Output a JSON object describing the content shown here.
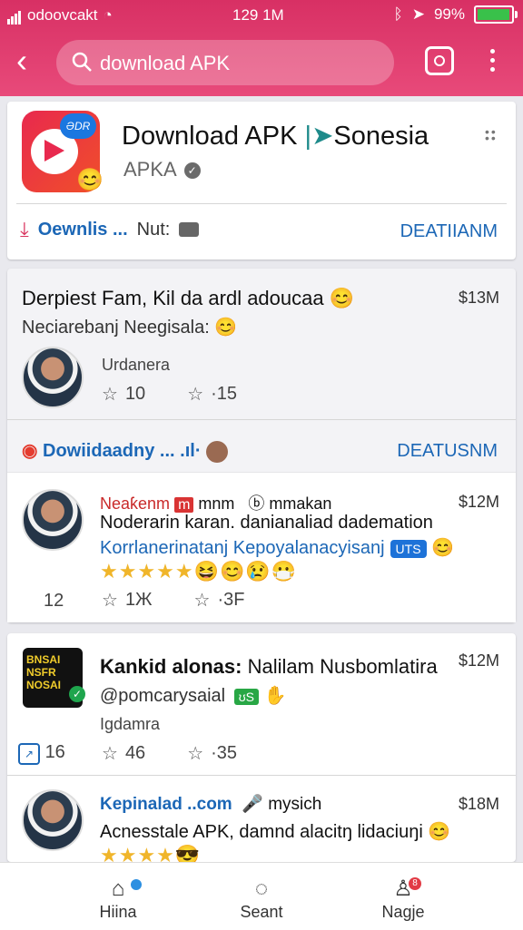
{
  "status": {
    "carrier": "odoovcakt",
    "time": "129 1M",
    "battery": "99%"
  },
  "search": {
    "query": "download APK"
  },
  "app": {
    "badge": "ƏDR",
    "title": "Download APK",
    "title_suffix": "Sonesia",
    "developer": "APKA",
    "downloads_label": "Oewnlis ...",
    "next_label": "Nut:",
    "detail_link": "DEATIIANM"
  },
  "post1": {
    "title": "Derpiest Fam, Kil da ardl adoucaa",
    "subtitle": "Neciarebanj Neegisala:",
    "price": "$13M",
    "author": "Urdanera",
    "likes": "10",
    "shares": "·15"
  },
  "section": {
    "label": "Dowiidaadny ...",
    "link": "DEATUSNM"
  },
  "post2": {
    "tag": "Neaƙenm",
    "handle_suffix": "mnm",
    "by": "mmakan",
    "price": "$12M",
    "line1": "Noderarin karan. danianaliad dademation",
    "line2": "Korrlanerinatanj Kepoyalanacyisanj",
    "badge": "UTS",
    "count": "12",
    "likes": "1Ж",
    "shares": "·3F"
  },
  "post3": {
    "title": "Kankid alonas:",
    "title_rest": "Nalilam Nusbomlatira",
    "icon_text": "BNSAI NSFR NOSAI",
    "price": "$12M",
    "handle": "@pomcarysaial",
    "badge": "ʊS",
    "author": "Igdamra",
    "count": "16",
    "likes": "46",
    "shares": "·35"
  },
  "post4": {
    "name": "Kepinalad ..com",
    "by": "mysich",
    "price": "$18M",
    "line": "Acnesstale APK, damnd alacitŋ lidaciuŋi"
  },
  "nav": {
    "home": "Hiina",
    "search": "Seant",
    "profile": "Nagje"
  },
  "colors": {
    "header": "#d83064",
    "link": "#1c67b6",
    "stars": "#f0b52a"
  }
}
